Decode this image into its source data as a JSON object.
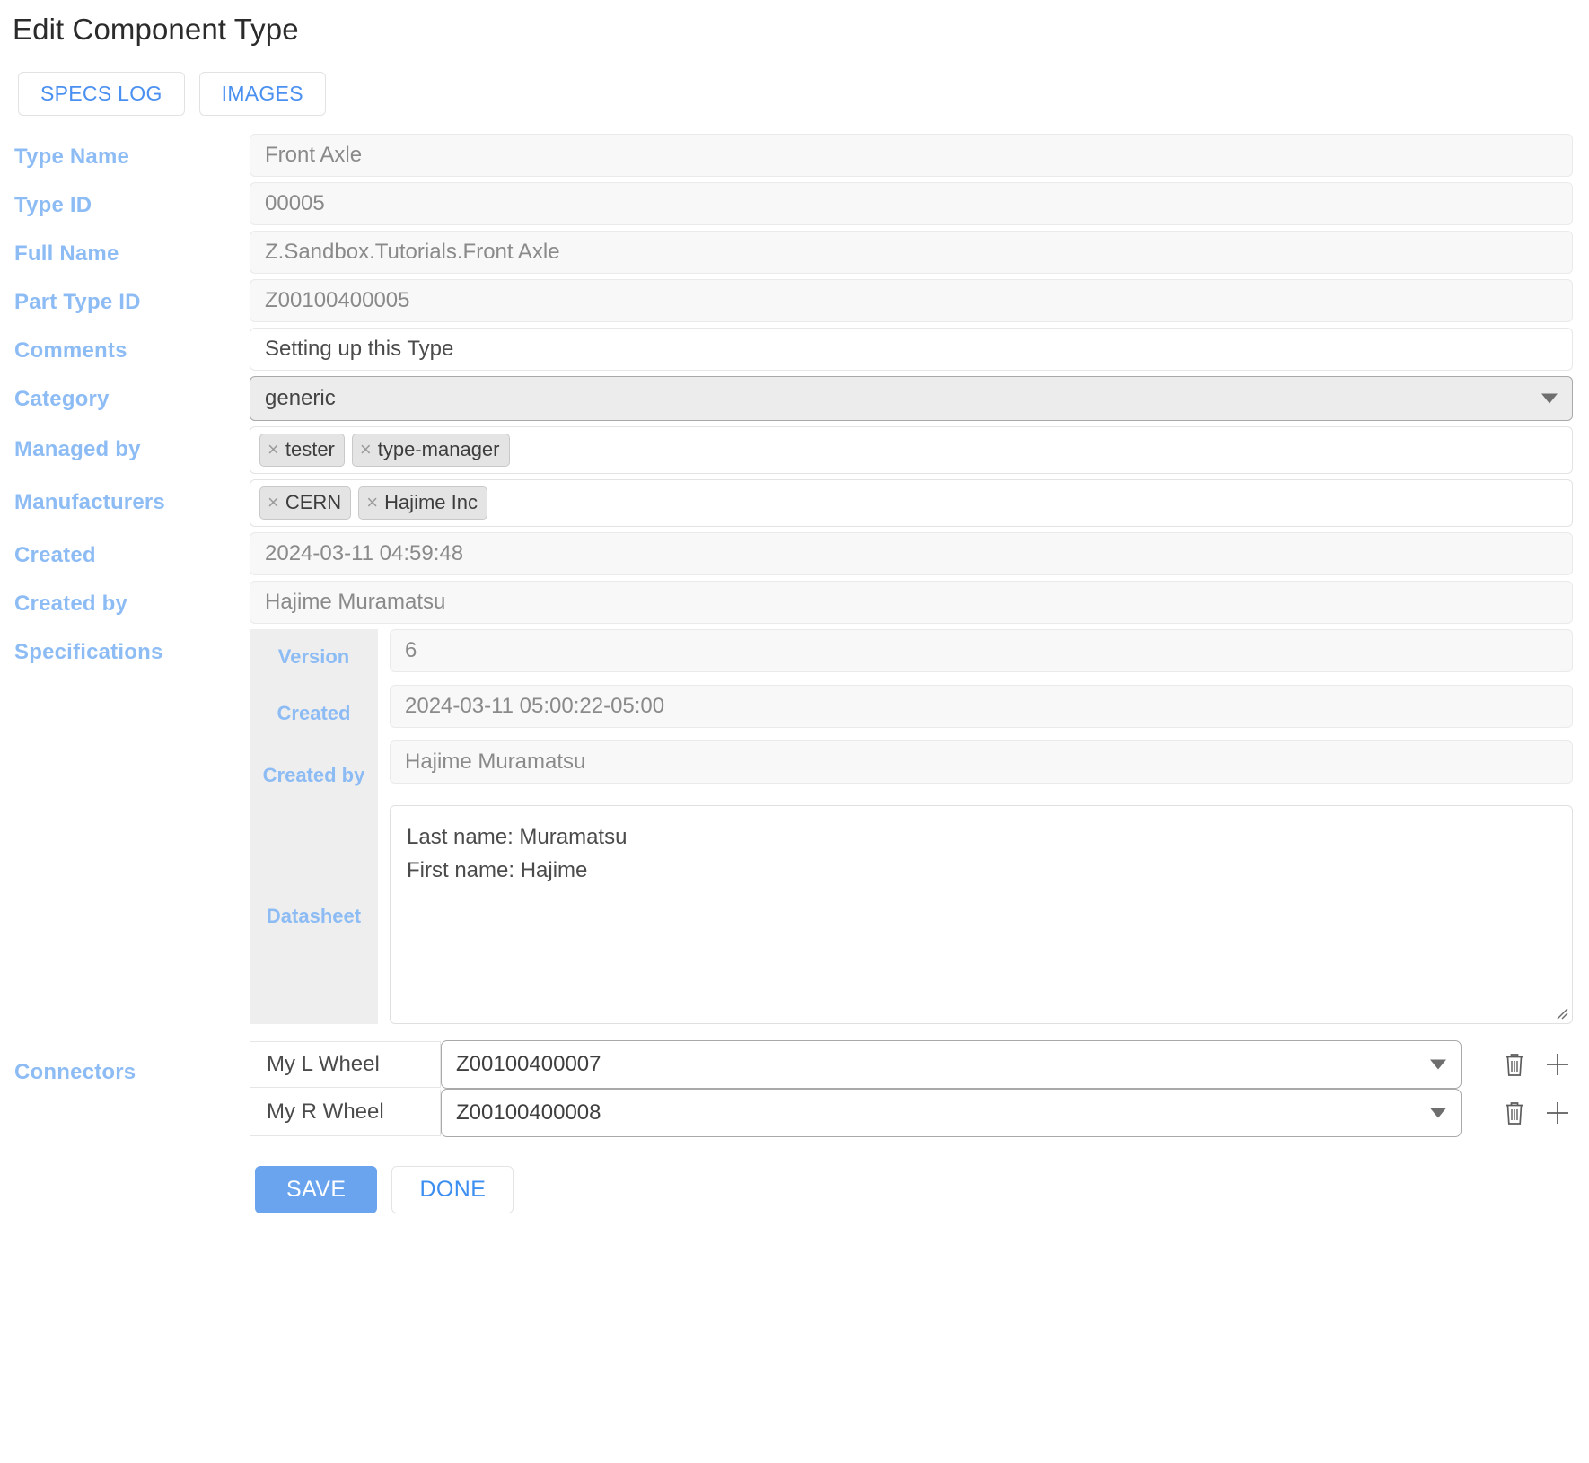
{
  "page": {
    "title": "Edit Component Type"
  },
  "tabs": [
    {
      "label": "SPECS LOG",
      "name": "specs-log"
    },
    {
      "label": "IMAGES",
      "name": "images"
    }
  ],
  "fields": {
    "type_name": {
      "label": "Type Name",
      "value": "Front Axle"
    },
    "type_id": {
      "label": "Type ID",
      "value": "00005"
    },
    "full_name": {
      "label": "Full Name",
      "value": "Z.Sandbox.Tutorials.Front Axle"
    },
    "part_type_id": {
      "label": "Part Type ID",
      "value": "Z00100400005"
    },
    "comments": {
      "label": "Comments",
      "value": "Setting up this Type"
    },
    "category": {
      "label": "Category",
      "value": "generic"
    },
    "managed_by": {
      "label": "Managed by",
      "tags": [
        "tester",
        "type-manager"
      ]
    },
    "manufacturers": {
      "label": "Manufacturers",
      "tags": [
        "CERN",
        "Hajime Inc"
      ]
    },
    "created": {
      "label": "Created",
      "value": "2024-03-11 04:59:48"
    },
    "created_by": {
      "label": "Created by",
      "value": "Hajime Muramatsu"
    }
  },
  "specifications": {
    "label": "Specifications",
    "version": {
      "label": "Version",
      "value": "6"
    },
    "created": {
      "label": "Created",
      "value": "2024-03-11 05:00:22-05:00"
    },
    "created_by": {
      "label": "Created by",
      "value": "Hajime Muramatsu"
    },
    "datasheet": {
      "label": "Datasheet",
      "value": "Last name: Muramatsu\nFirst name: Hajime"
    }
  },
  "connectors": {
    "label": "Connectors",
    "rows": [
      {
        "name": "My L Wheel",
        "value": "Z00100400007"
      },
      {
        "name": "My R Wheel",
        "value": "Z00100400008"
      }
    ],
    "delete_icon": "trash-icon",
    "add_icon": "plus-icon"
  },
  "footer": {
    "save": "SAVE",
    "done": "DONE"
  },
  "colors": {
    "label_blue": "#8dbcf5",
    "link_blue": "#4a90f0",
    "save_blue": "#6aa4ef"
  }
}
